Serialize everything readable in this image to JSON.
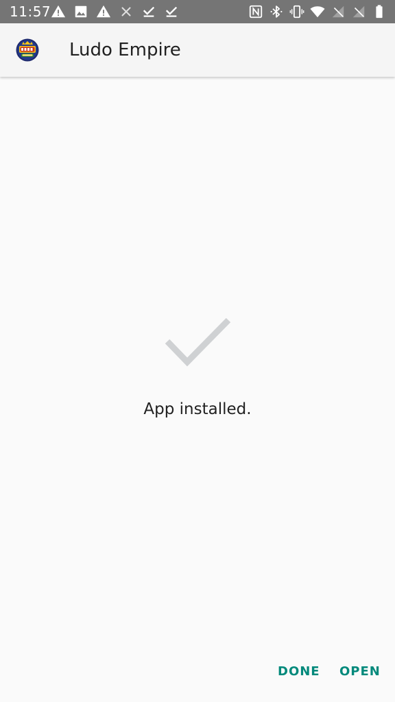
{
  "status_bar": {
    "time": "11:57",
    "left_icons": [
      "warning-icon",
      "image-icon",
      "warning-icon",
      "close-icon",
      "download-done-icon",
      "download-done-icon"
    ],
    "right_icons": [
      "nfc-icon",
      "bluetooth-icon",
      "vibrate-icon",
      "wifi-icon",
      "signal-off-icon",
      "signal-off-icon",
      "battery-icon"
    ]
  },
  "app_bar": {
    "icon": "ludo-empire-app-icon",
    "title": "Ludo Empire"
  },
  "content": {
    "icon": "check-icon",
    "message": "App installed."
  },
  "actions": {
    "done_label": "DONE",
    "open_label": "OPEN"
  },
  "colors": {
    "status_bar": "#757575",
    "app_bar": "#f5f5f5",
    "background": "#fafafa",
    "accent": "#00897b",
    "check": "#cfd1d3"
  }
}
